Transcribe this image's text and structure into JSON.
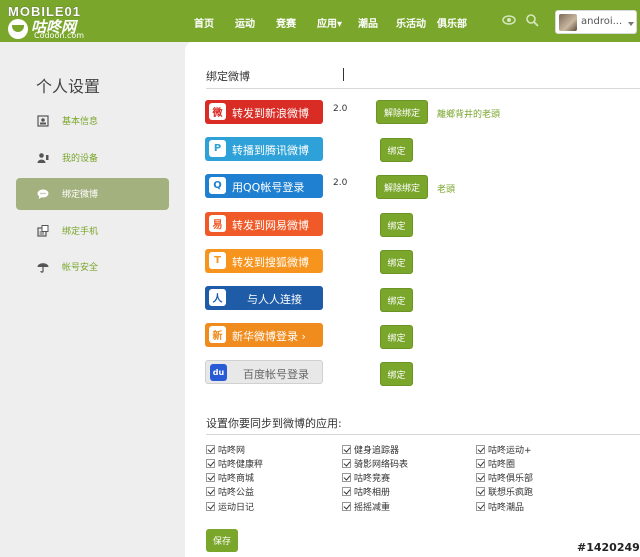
{
  "header": {
    "logo_top": "MOBILE01",
    "logo_cn": "咕咚网",
    "logo_en": "Codoon.com",
    "nav": [
      "首页",
      "运动",
      "竞赛",
      "应用▾",
      "潮品",
      "乐活动",
      "俱乐部"
    ],
    "user_name": "androi...",
    "icons": [
      "eye-icon",
      "search-icon",
      "chevron-down-icon"
    ]
  },
  "sidebar": {
    "title": "个人设置",
    "items": [
      {
        "label": "基本信息",
        "icon": "id-card-icon"
      },
      {
        "label": "我的设备",
        "icon": "user-device-icon"
      },
      {
        "label": "绑定微博",
        "icon": "chat-bubble-icon",
        "active": true
      },
      {
        "label": "绑定手机",
        "icon": "phone-icon"
      },
      {
        "label": "帐号安全",
        "icon": "umbrella-icon"
      }
    ]
  },
  "main": {
    "title": "绑定微博",
    "services": [
      {
        "label": "转发到新浪微博",
        "badge": "微",
        "color": "#d82c24",
        "version": "2.0",
        "action": "解除绑定",
        "account": "離鄉背井的老頭"
      },
      {
        "label": "转播到腾讯微博",
        "badge": "P",
        "color": "#2ea2d8",
        "version": "",
        "action": "绑定",
        "account": ""
      },
      {
        "label": "用QQ帐号登录",
        "badge": "Q",
        "color": "#1f7fd0",
        "version": "2.0",
        "action": "解除绑定",
        "account": "老頭"
      },
      {
        "label": "转发到网易微博",
        "badge": "易",
        "color": "#f05a28",
        "version": "",
        "action": "绑定",
        "account": ""
      },
      {
        "label": "转发到搜狐微博",
        "badge": "T",
        "color": "#f7941d",
        "version": "",
        "action": "绑定",
        "account": ""
      },
      {
        "label": "与人人连接",
        "badge": "人",
        "color": "#1e5ca8",
        "version": "",
        "action": "绑定",
        "account": ""
      },
      {
        "label": "新华微博登录 ›",
        "badge": "新",
        "color": "#f08c1e",
        "version": "",
        "action": "绑定",
        "account": ""
      },
      {
        "label": "百度帐号登录",
        "badge": "du",
        "color": "#e8e8e8",
        "version": "",
        "action": "绑定",
        "account": ""
      }
    ],
    "sync_title": "设置你要同步到微博的应用:",
    "sync_apps": [
      [
        "咕咚网",
        "咕咚健康秤",
        "咕咚商城",
        "咕咚公益",
        "运动日记"
      ],
      [
        "健身追踪器",
        "骑影网络码表",
        "咕咚竞赛",
        "咕咚相册",
        "摇摇减重"
      ],
      [
        "咕咚运动+",
        "咕咚圈",
        "咕咚俱乐部",
        "联想乐疯跑",
        "咕咚潮品"
      ]
    ],
    "save_label": "保存"
  },
  "watermark": "#1420249"
}
